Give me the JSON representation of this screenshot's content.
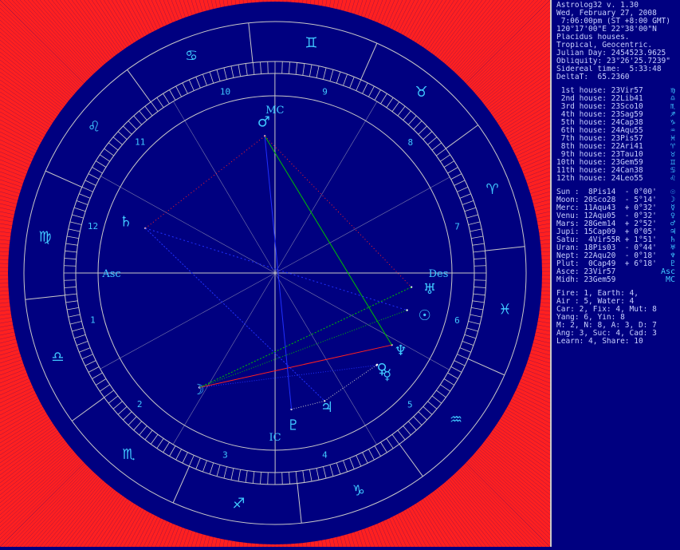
{
  "header": {
    "title": "Astrolog32 v. 1.30",
    "date": "Wed, February 27, 2008",
    "time": " 7:06:00pm (ST +8:00 GMT)",
    "location": "120°17'00\"E 22°38'00\"N",
    "houses": "Placidus houses.",
    "zodiac": "Tropical, Geocentric.",
    "julian_day": "Julian Day: 2454523.9625",
    "obliquity": "Obliquity: 23°26'25.7239\"",
    "sidereal": "Sidereal time:  5:33:48",
    "delta_t": "DeltaT:  65.2360"
  },
  "house_cusps": [
    {
      "label": " 1st house: 23Vir57",
      "glyph": "♍"
    },
    {
      "label": " 2nd house: 22Lib41",
      "glyph": "♎"
    },
    {
      "label": " 3rd house: 23Sco10",
      "glyph": "♏"
    },
    {
      "label": " 4th house: 23Sag59",
      "glyph": "♐"
    },
    {
      "label": " 5th house: 24Cap38",
      "glyph": "♑"
    },
    {
      "label": " 6th house: 24Aqu55",
      "glyph": "♒"
    },
    {
      "label": " 7th house: 23Pis57",
      "glyph": "♓"
    },
    {
      "label": " 8th house: 22Ari41",
      "glyph": "♈"
    },
    {
      "label": " 9th house: 23Tau10",
      "glyph": "♉"
    },
    {
      "label": "10th house: 23Gem59",
      "glyph": "♊"
    },
    {
      "label": "11th house: 24Can38",
      "glyph": "♋"
    },
    {
      "label": "12th house: 24Leo55",
      "glyph": "♌"
    }
  ],
  "planets": [
    {
      "label": "Sun :  8Pis14  - 0°00'",
      "glyph": "☉"
    },
    {
      "label": "Moon: 20Sco28  - 5°14'",
      "glyph": "☽"
    },
    {
      "label": "Merc: 11Aqu43  + 0°32'",
      "glyph": "☿"
    },
    {
      "label": "Venu: 12Aqu05  - 0°32'",
      "glyph": "♀"
    },
    {
      "label": "Mars: 28Gem14  + 2°52'",
      "glyph": "♂"
    },
    {
      "label": "Jupi: 15Cap09  + 0°05'",
      "glyph": "♃"
    },
    {
      "label": "Satu:  4Vir55R + 1°51'",
      "glyph": "♄"
    },
    {
      "label": "Uran: 18Pis03  - 0°44'",
      "glyph": "♅"
    },
    {
      "label": "Nept: 22Aqu20  - 0°18'",
      "glyph": "♆"
    },
    {
      "label": "Plut:  0Cap49  + 6°18'",
      "glyph": "♇"
    },
    {
      "label": "Asce: 23Vir57",
      "glyph": "Asc"
    },
    {
      "label": "Midh: 23Gem59",
      "glyph": "MC"
    }
  ],
  "stats": {
    "elements": "Fire: 1, Earth: 4,",
    "elements2": "Air : 5, Water: 4",
    "modes": "Car: 2, Fix: 4, Mut: 8",
    "yang": "Yang: 6, Yin: 8",
    "hemis": "M: 2, N: 8, A: 3, D: 7",
    "ang": "Ang: 3, Suc: 4, Cad: 3",
    "learn": "Learn: 4, Share: 10"
  },
  "wheel": {
    "asc_label": "Asc",
    "mc_label": "MC",
    "ic_label": "IC",
    "des_label": "Des",
    "house_numbers": [
      "1",
      "2",
      "3",
      "4",
      "5",
      "6",
      "7",
      "8",
      "9",
      "10",
      "11",
      "12"
    ],
    "sign_glyphs": [
      "♈",
      "♉",
      "♊",
      "♋",
      "♌",
      "♍",
      "♎",
      "♏",
      "♐",
      "♑",
      "♒",
      "♓"
    ],
    "planet_glyphs": {
      "sun": "☉",
      "moon": "☽",
      "mercury": "☿",
      "venus": "♀",
      "mars": "♂",
      "jupiter": "♃",
      "saturn": "♄",
      "uranus": "♅",
      "neptune": "♆",
      "pluto": "♇"
    }
  },
  "colors": {
    "background": "#000080",
    "outer_red": "#ff2020",
    "wheel_lines": "#c8c8c8",
    "glyphs": "#40c8ff",
    "aspect_green": "#00c000",
    "aspect_red": "#ff2020",
    "aspect_blue": "#2030ff"
  }
}
